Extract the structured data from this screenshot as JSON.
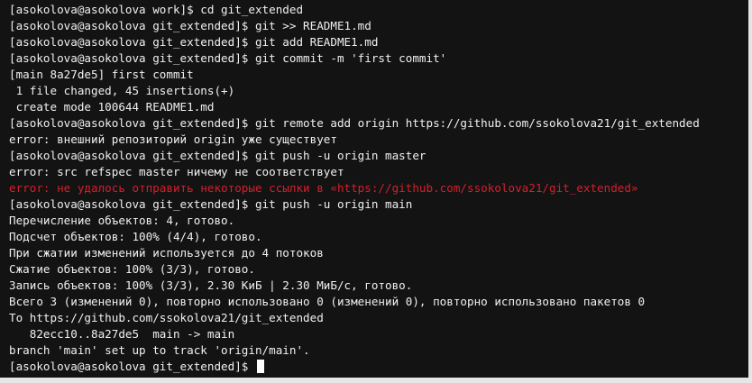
{
  "terminal": {
    "lines": [
      {
        "text": "[asokolova@asokolova work]$ cd git_extended",
        "color": "#f0f0f0"
      },
      {
        "text": "[asokolova@asokolova git_extended]$ git >> README1.md",
        "color": "#f0f0f0"
      },
      {
        "text": "[asokolova@asokolova git_extended]$ git add README1.md",
        "color": "#f0f0f0"
      },
      {
        "text": "[asokolova@asokolova git_extended]$ git commit -m 'first commit'",
        "color": "#f0f0f0"
      },
      {
        "text": "[main 8a27de5] first commit",
        "color": "#f0f0f0"
      },
      {
        "text": " 1 file changed, 45 insertions(+)",
        "color": "#f0f0f0"
      },
      {
        "text": " create mode 100644 README1.md",
        "color": "#f0f0f0"
      },
      {
        "text": "[asokolova@asokolova git_extended]$ git remote add origin https://github.com/ssokolova21/git_extended",
        "color": "#f0f0f0"
      },
      {
        "text": "error: внешний репозиторий origin уже существует",
        "color": "#f0f0f0"
      },
      {
        "text": "[asokolova@asokolova git_extended]$ git push -u origin master",
        "color": "#f0f0f0"
      },
      {
        "text": "error: src refspec master ничему не соответствует",
        "color": "#f0f0f0"
      },
      {
        "text": "error: не удалось отправить некоторые ссылки в «https://github.com/ssokolova21/git_extended»",
        "color": "#d2202c"
      },
      {
        "text": "[asokolova@asokolova git_extended]$ git push -u origin main",
        "color": "#f0f0f0"
      },
      {
        "text": "Перечисление объектов: 4, готово.",
        "color": "#f0f0f0"
      },
      {
        "text": "Подсчет объектов: 100% (4/4), готово.",
        "color": "#f0f0f0"
      },
      {
        "text": "При сжатии изменений используется до 4 потоков",
        "color": "#f0f0f0"
      },
      {
        "text": "Сжатие объектов: 100% (3/3), готово.",
        "color": "#f0f0f0"
      },
      {
        "text": "Запись объектов: 100% (3/3), 2.30 КиБ | 2.30 МиБ/с, готово.",
        "color": "#f0f0f0"
      },
      {
        "text": "Всего 3 (изменений 0), повторно использовано 0 (изменений 0), повторно использовано пакетов 0",
        "color": "#f0f0f0"
      },
      {
        "text": "To https://github.com/ssokolova21/git_extended",
        "color": "#f0f0f0"
      },
      {
        "text": "   82ecc10..8a27de5  main -> main",
        "color": "#f0f0f0"
      },
      {
        "text": "branch 'main' set up to track 'origin/main'.",
        "color": "#f0f0f0"
      }
    ],
    "prompt": "[asokolova@asokolova git_extended]$ ",
    "background": "#131313",
    "foreground": "#f0f0f0",
    "error_color": "#d2202c"
  }
}
